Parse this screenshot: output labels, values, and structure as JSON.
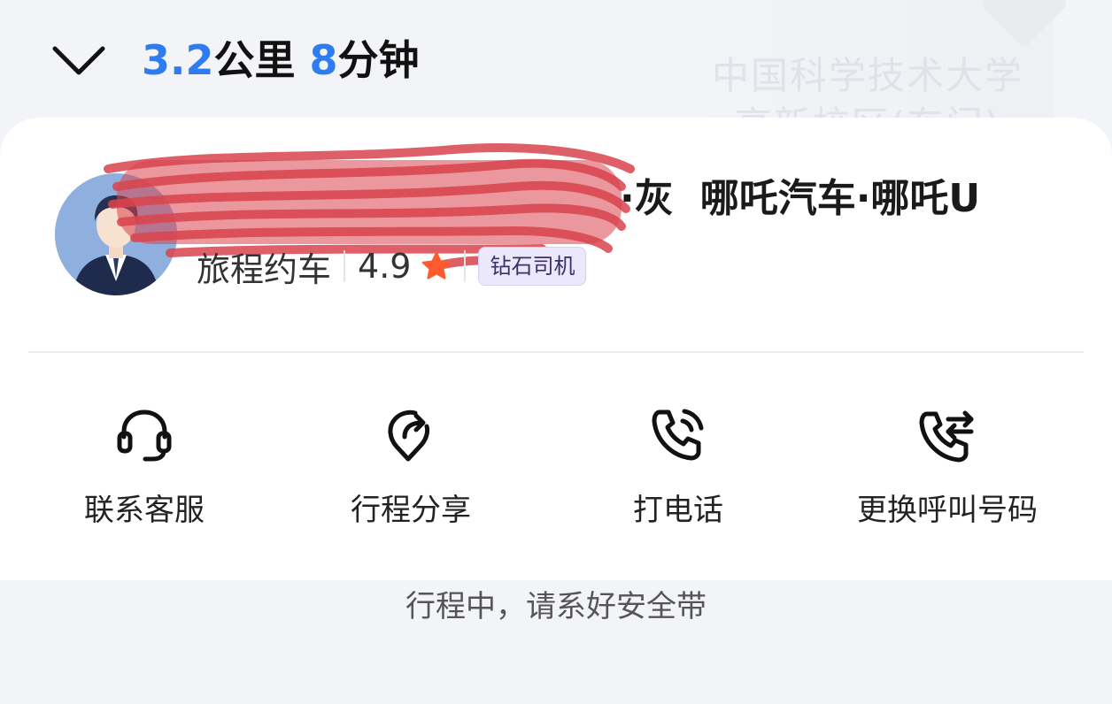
{
  "map": {
    "place_label_line1": "中国科学技术大学",
    "place_label_line2": "高新校区(东门)"
  },
  "header": {
    "distance_value": "3.2",
    "distance_unit": "公里",
    "time_value": "8",
    "time_unit": "分钟",
    "collapse_icon": "chevron-down-icon"
  },
  "driver": {
    "car_color": "·灰",
    "car_model": "哪吒汽车·哪吒U",
    "service": "旅程约车",
    "rating": "4.9",
    "badge": "钻石司机",
    "star_color": "#ff5a2c"
  },
  "actions": [
    {
      "label": "联系客服",
      "icon": "headset-icon"
    },
    {
      "label": "行程分享",
      "icon": "share-location-icon"
    },
    {
      "label": "打电话",
      "icon": "phone-call-icon"
    },
    {
      "label": "更换呼叫号码",
      "icon": "phone-switch-icon"
    }
  ],
  "footer": {
    "tip": "行程中，请系好安全带"
  },
  "colors": {
    "accent": "#2f7cf0",
    "background": "#f2f4f8",
    "card": "#ffffff"
  }
}
